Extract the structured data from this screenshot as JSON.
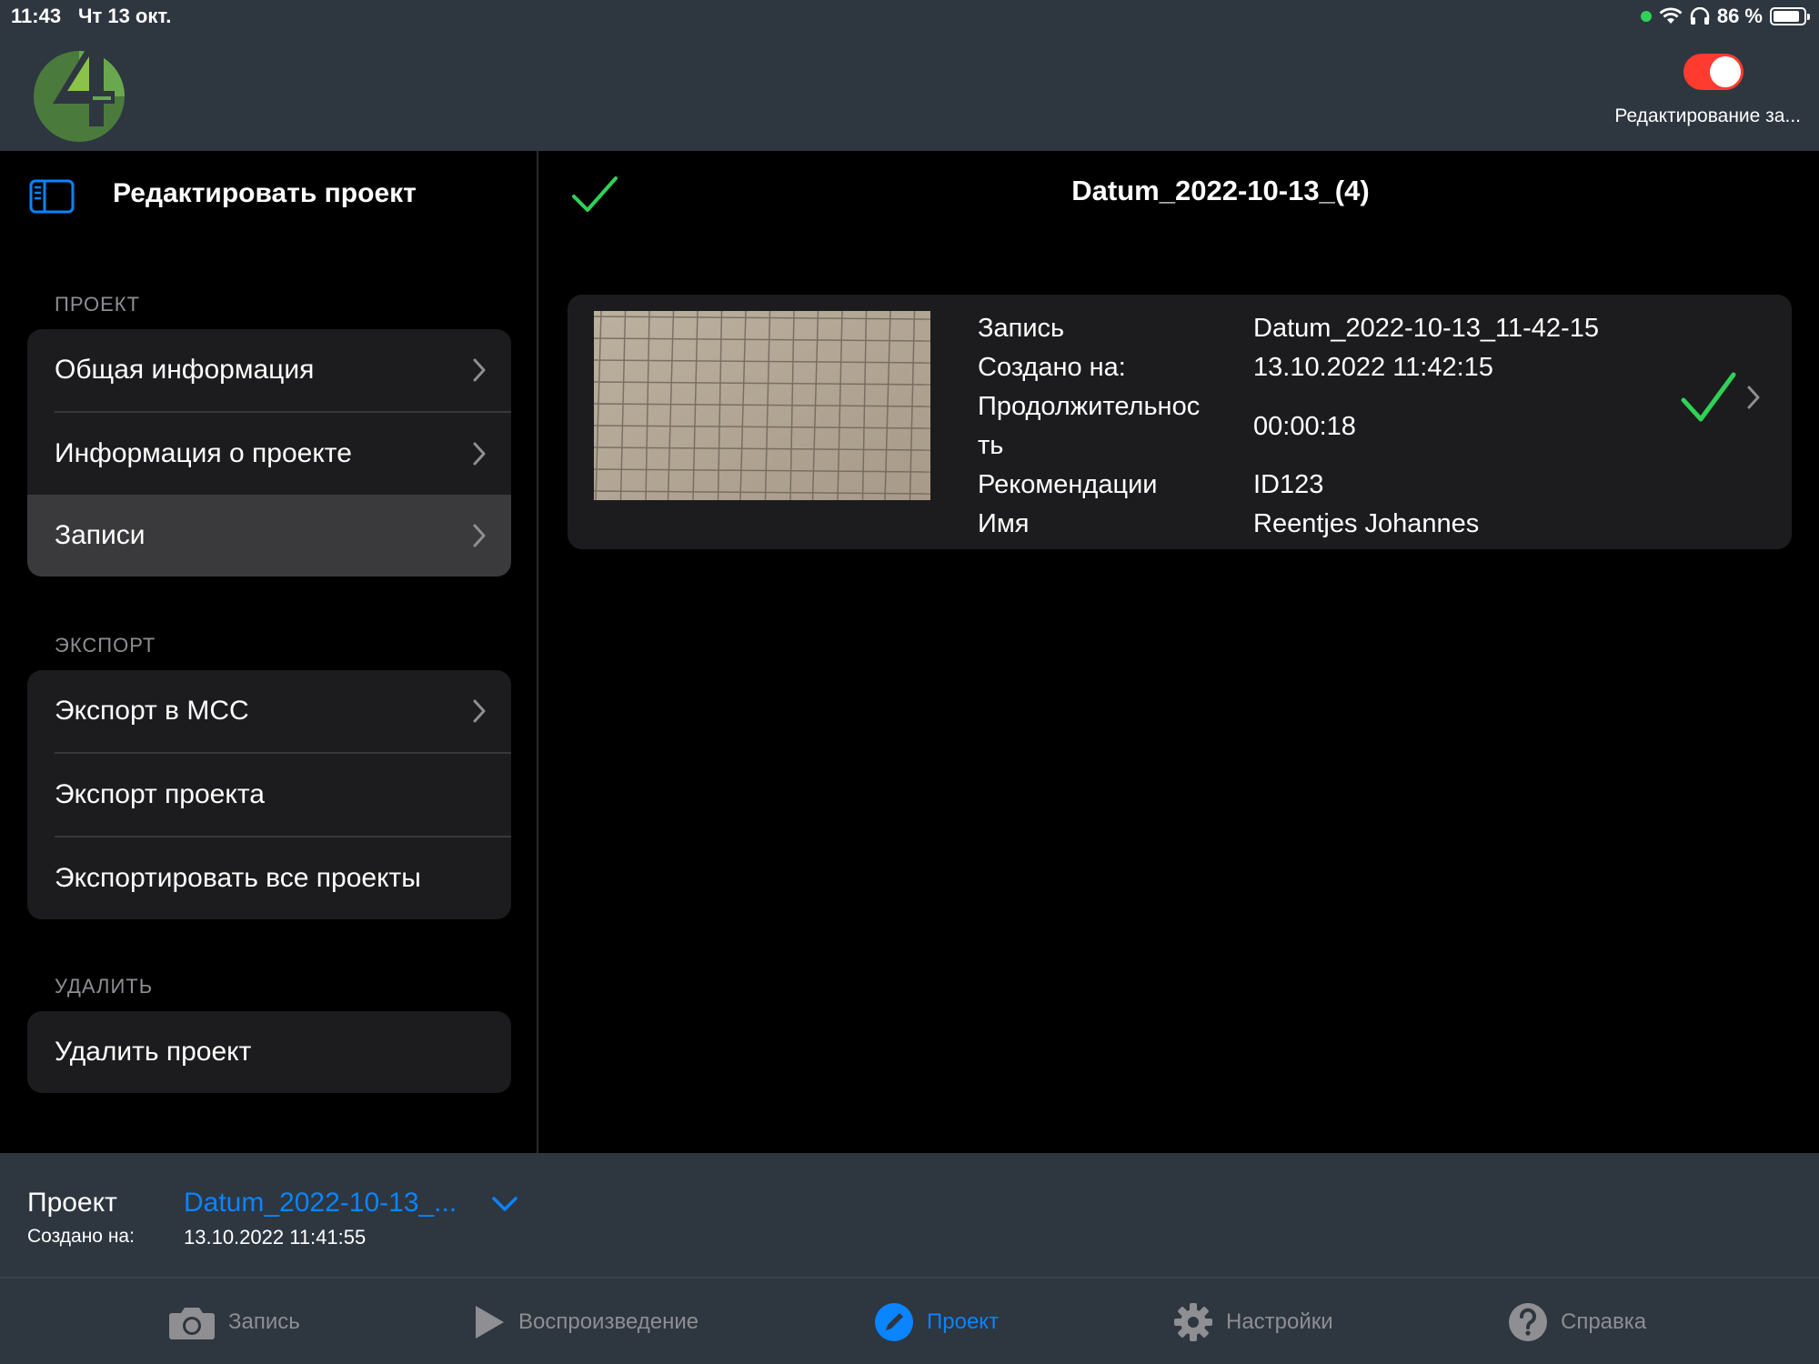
{
  "status_bar": {
    "time": "11:43",
    "date": "Чт 13 окт.",
    "battery": "86 %",
    "battery_level": 0.86
  },
  "header": {
    "edit_toggle_label": "Редактирование за...",
    "edit_toggle_on": true,
    "toggle_color": "#ff3b30"
  },
  "sidebar": {
    "title": "Редактировать проект",
    "sections": [
      {
        "header": "ПРОЕКТ",
        "items": [
          {
            "label": "Общая информация",
            "chevron": true
          },
          {
            "label": "Информация о проекте",
            "chevron": true
          },
          {
            "label": "Записи",
            "chevron": true,
            "selected": true
          }
        ]
      },
      {
        "header": "ЭКСПОРТ",
        "items": [
          {
            "label": "Экспорт в MCC",
            "chevron": true
          },
          {
            "label": "Экспорт проекта",
            "chevron": false
          },
          {
            "label": "Экспортировать все проекты",
            "chevron": false
          }
        ]
      },
      {
        "header": "УДАЛИТЬ",
        "items": [
          {
            "label": "Удалить проект",
            "chevron": false
          }
        ]
      }
    ]
  },
  "main": {
    "title": "Datum_2022-10-13_(4)",
    "record": {
      "labels": [
        "Запись",
        "Создано на:",
        "Продолжительнос",
        "ть",
        "Рекомендации",
        "Имя"
      ],
      "record_name": "Datum_2022-10-13_11-42-15",
      "created": "13.10.2022 11:42:15",
      "duration": "00:00:18",
      "recommendation": "ID123",
      "name": "Reentjes Johannes"
    }
  },
  "project_bar": {
    "label": "Проект",
    "created_label": "Создано на:",
    "project_name": "Datum_2022-10-13_...",
    "created_date": "13.10.2022 11:41:55"
  },
  "tabs": [
    {
      "label": "Запись",
      "icon": "camera-icon"
    },
    {
      "label": "Воспроизведение",
      "icon": "play-icon"
    },
    {
      "label": "Проект",
      "icon": "pencil-icon",
      "active": true
    },
    {
      "label": "Настройки",
      "icon": "gear-icon"
    },
    {
      "label": "Справка",
      "icon": "help-icon"
    }
  ],
  "colors": {
    "accent": "#0a84ff",
    "check": "#30d158",
    "header_bg": "#2e3640"
  }
}
